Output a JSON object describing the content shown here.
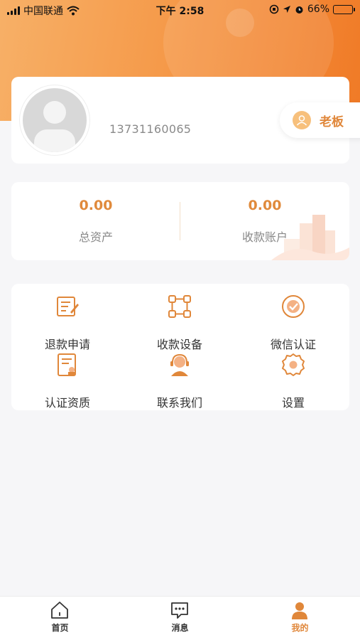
{
  "status_bar": {
    "carrier": "中国联通",
    "time": "下午 2:58",
    "battery": "66%"
  },
  "profile": {
    "phone": "13731160065",
    "role": "老板"
  },
  "assets": [
    {
      "value": "0.00",
      "label": "总资产"
    },
    {
      "value": "0.00",
      "label": "收款账户"
    }
  ],
  "menu": [
    {
      "label": "退款申请",
      "icon": "refund-form-icon"
    },
    {
      "label": "收款设备",
      "icon": "device-network-icon"
    },
    {
      "label": "微信认证",
      "icon": "certified-badge-icon"
    },
    {
      "label": "认证资质",
      "icon": "certificate-document-icon"
    },
    {
      "label": "联系我们",
      "icon": "customer-service-icon"
    },
    {
      "label": "设置",
      "icon": "gear-icon"
    }
  ],
  "tabs": [
    {
      "label": "首页",
      "icon": "home-icon"
    },
    {
      "label": "消息",
      "icon": "message-icon"
    },
    {
      "label": "我的",
      "icon": "user-icon",
      "active": true
    }
  ],
  "colors": {
    "accent": "#e0873a",
    "header_gradient_start": "#f7b067",
    "header_gradient_end": "#f07a26"
  }
}
